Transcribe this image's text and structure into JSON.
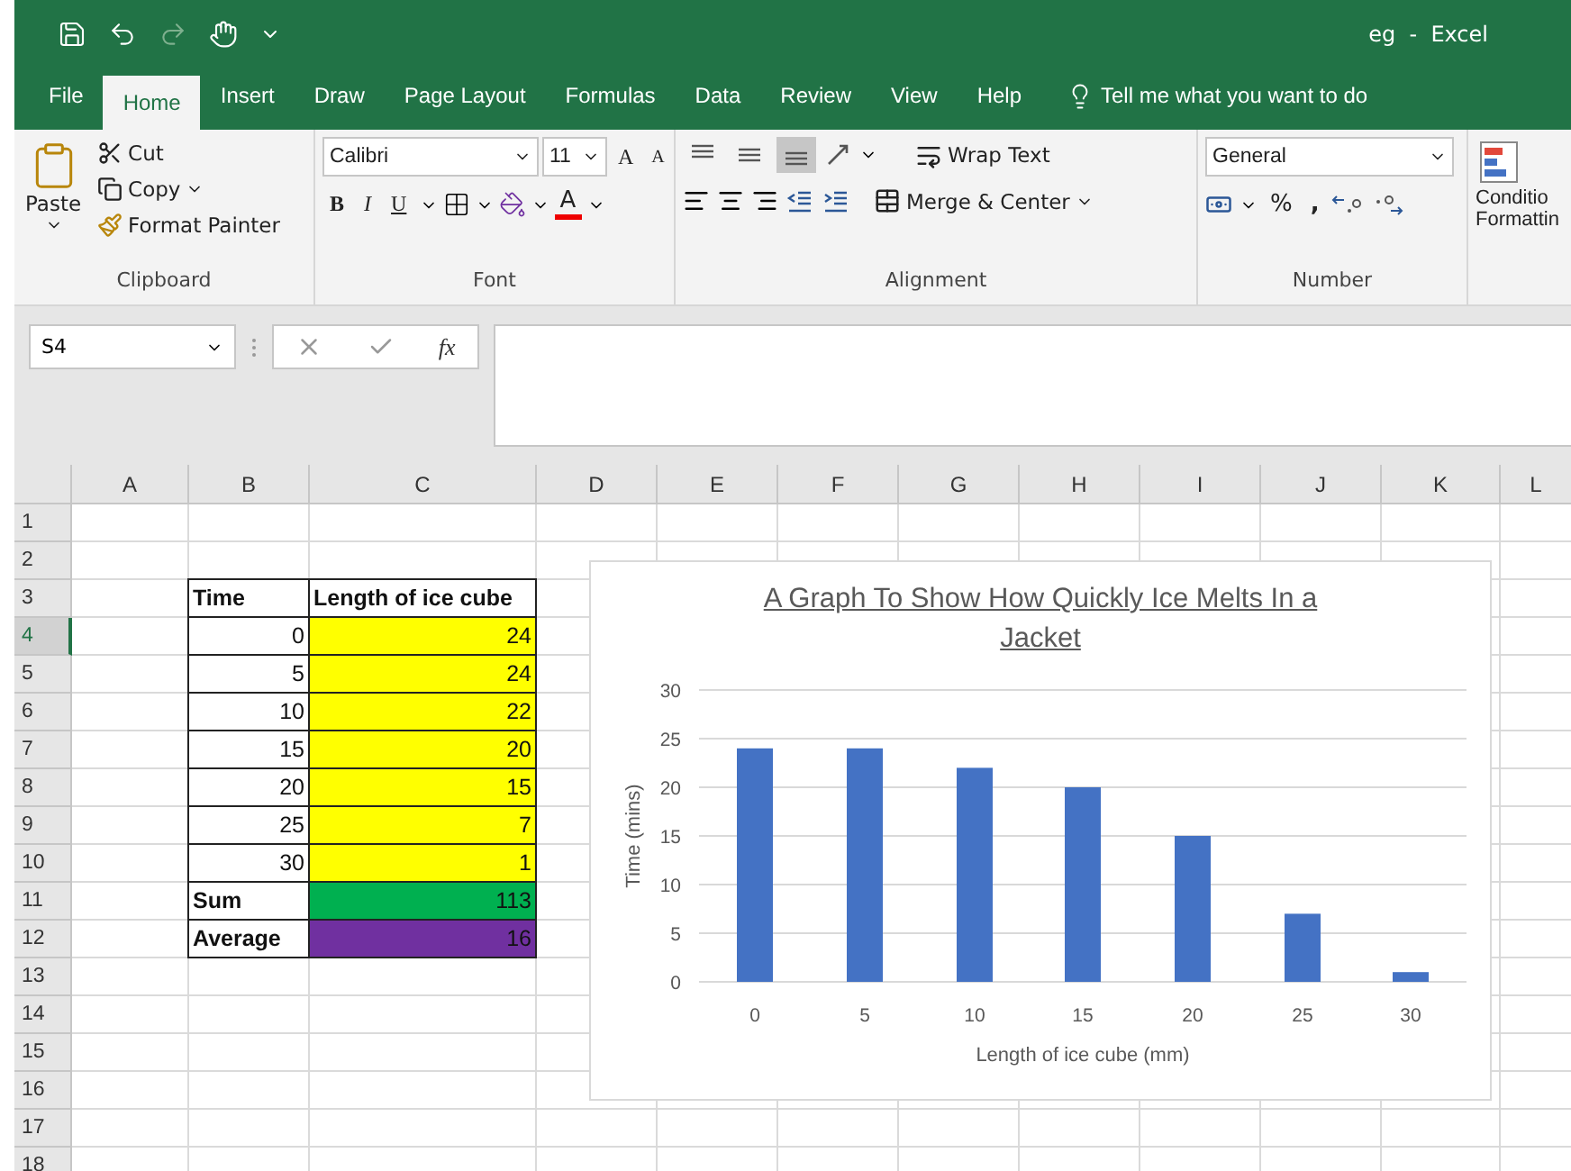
{
  "window": {
    "title": "eg  -  Excel"
  },
  "tabs": [
    {
      "label": "File",
      "selected": false
    },
    {
      "label": "Home",
      "selected": true
    },
    {
      "label": "Insert",
      "selected": false
    },
    {
      "label": "Draw",
      "selected": false
    },
    {
      "label": "Page Layout",
      "selected": false
    },
    {
      "label": "Formulas",
      "selected": false
    },
    {
      "label": "Data",
      "selected": false
    },
    {
      "label": "Review",
      "selected": false
    },
    {
      "label": "View",
      "selected": false
    },
    {
      "label": "Help",
      "selected": false
    }
  ],
  "tell_me": {
    "placeholder": "Tell me what you want to do"
  },
  "ribbon": {
    "clipboard": {
      "paste": "Paste",
      "cut": "Cut",
      "copy": "Copy",
      "format_painter": "Format Painter",
      "label": "Clipboard"
    },
    "font": {
      "font_name": "Calibri",
      "font_size": "11",
      "grow": "A",
      "shrink": "A",
      "bold": "B",
      "italic": "I",
      "underline": "U",
      "font_color": "A",
      "label": "Font"
    },
    "alignment": {
      "vertical": [
        {
          "selected": false
        },
        {
          "selected": false
        },
        {
          "selected": true
        }
      ],
      "wrap_text": "Wrap Text",
      "merge_center": "Merge & Center",
      "label": "Alignment"
    },
    "number": {
      "format": "General",
      "percent": "%",
      "comma": ",",
      "label": "Number"
    },
    "styles": {
      "conditional_line1": "Conditio",
      "conditional_line2": "Formattin"
    }
  },
  "formula_bar": {
    "name_box": "S4",
    "fx": "fx"
  },
  "sheet": {
    "columns": [
      "A",
      "B",
      "C",
      "D",
      "E",
      "F",
      "G",
      "H",
      "I",
      "J",
      "K",
      "L"
    ],
    "rows": [
      {
        "number": "1",
        "selected": false
      },
      {
        "number": "2",
        "selected": false
      },
      {
        "number": "3",
        "selected": false,
        "b": {
          "text": "Time",
          "kind": "label"
        },
        "c": {
          "text": "Length of ice cube",
          "kind": "label"
        }
      },
      {
        "number": "4",
        "selected": true,
        "b": {
          "text": "0",
          "kind": "number"
        },
        "c": {
          "text": "24",
          "kind": "number",
          "color": "#ffff00"
        }
      },
      {
        "number": "5",
        "selected": false,
        "b": {
          "text": "5",
          "kind": "number"
        },
        "c": {
          "text": "24",
          "kind": "number",
          "color": "#ffff00"
        }
      },
      {
        "number": "6",
        "selected": false,
        "b": {
          "text": "10",
          "kind": "number"
        },
        "c": {
          "text": "22",
          "kind": "number",
          "color": "#ffff00"
        }
      },
      {
        "number": "7",
        "selected": false,
        "b": {
          "text": "15",
          "kind": "number"
        },
        "c": {
          "text": "20",
          "kind": "number",
          "color": "#ffff00"
        }
      },
      {
        "number": "8",
        "selected": false,
        "b": {
          "text": "20",
          "kind": "number"
        },
        "c": {
          "text": "15",
          "kind": "number",
          "color": "#ffff00"
        }
      },
      {
        "number": "9",
        "selected": false,
        "b": {
          "text": "25",
          "kind": "number"
        },
        "c": {
          "text": "7",
          "kind": "number",
          "color": "#ffff00"
        }
      },
      {
        "number": "10",
        "selected": false,
        "b": {
          "text": "30",
          "kind": "number"
        },
        "c": {
          "text": "1",
          "kind": "number",
          "color": "#ffff00"
        }
      },
      {
        "number": "11",
        "selected": false,
        "b": {
          "text": "Sum",
          "kind": "label"
        },
        "c": {
          "text": "113",
          "kind": "number",
          "color": "#00b050"
        }
      },
      {
        "number": "12",
        "selected": false,
        "b": {
          "text": "Average",
          "kind": "label"
        },
        "c": {
          "text": "16",
          "kind": "number",
          "color": "#7030a0"
        }
      },
      {
        "number": "13",
        "selected": false
      },
      {
        "number": "14",
        "selected": false
      },
      {
        "number": "15",
        "selected": false
      },
      {
        "number": "16",
        "selected": false
      },
      {
        "number": "17",
        "selected": false
      },
      {
        "number": "18",
        "selected": false
      }
    ],
    "chart": {
      "chart_data": {
        "type": "bar",
        "title": "A Graph To Show How Quickly Ice Melts In a Jacket",
        "xlabel": "Length of ice cube (mm)",
        "ylabel": "Time (mins)",
        "categories": [
          "0",
          "5",
          "10",
          "15",
          "20",
          "25",
          "30"
        ],
        "series": [
          {
            "color": "#4472c4",
            "values": [
              24,
              24,
              22,
              20,
              15,
              7,
              1
            ]
          }
        ],
        "grid": true,
        "ylim": [
          0,
          30
        ],
        "yticks": [
          0,
          5,
          10,
          15,
          20,
          25,
          30
        ]
      }
    }
  }
}
